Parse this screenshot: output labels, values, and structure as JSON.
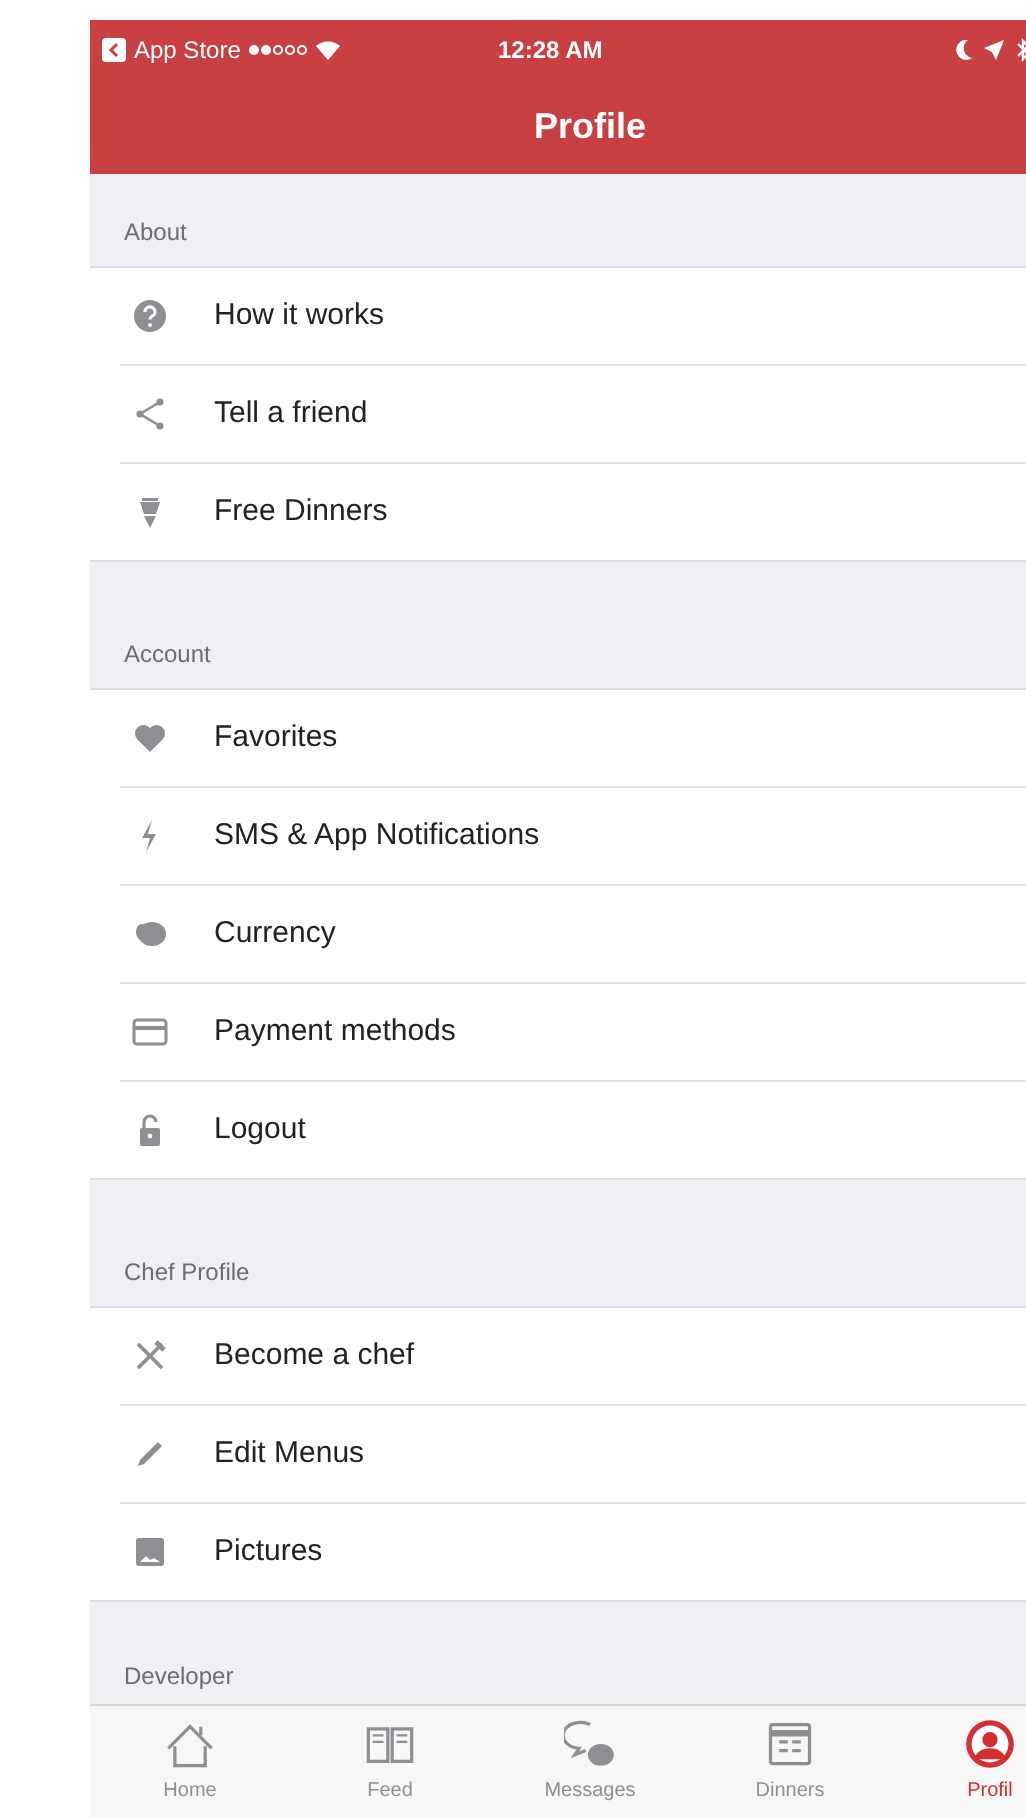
{
  "status_bar": {
    "carrier": "App Store",
    "time": "12:28 AM"
  },
  "nav_bar": {
    "title": "Profile"
  },
  "sections": [
    {
      "title": "About",
      "items": [
        {
          "label": "How it works"
        },
        {
          "label": "Tell a friend"
        },
        {
          "label": "Free Dinners"
        }
      ]
    },
    {
      "title": "Account",
      "items": [
        {
          "label": "Favorites"
        },
        {
          "label": "SMS & App Notifications"
        },
        {
          "label": "Currency"
        },
        {
          "label": "Payment methods"
        },
        {
          "label": "Logout"
        }
      ]
    },
    {
      "title": "Chef Profile",
      "items": [
        {
          "label": "Become a chef"
        },
        {
          "label": "Edit Menus"
        },
        {
          "label": "Pictures"
        }
      ]
    },
    {
      "title": "Developer"
    }
  ],
  "tab_bar": {
    "tabs": [
      {
        "label": "Home",
        "selected": false
      },
      {
        "label": "Feed",
        "selected": false
      },
      {
        "label": "Messages",
        "selected": false
      },
      {
        "label": "Dinners",
        "selected": false
      },
      {
        "label": "Profil",
        "selected": true
      }
    ]
  }
}
